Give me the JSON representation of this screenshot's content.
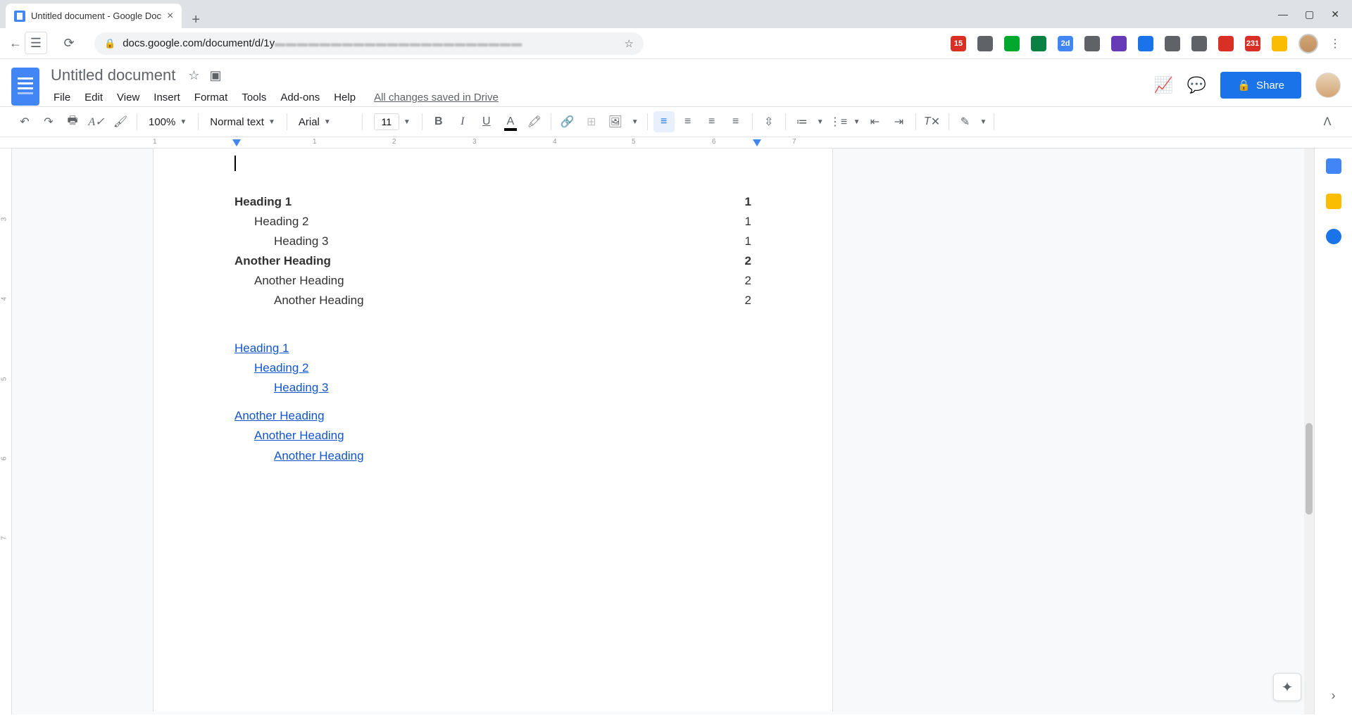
{
  "browser": {
    "tab_title": "Untitled document - Google Doc",
    "url_prefix": "docs.google.com/document/d/1y",
    "url_blur": "▬▬▬▬▬▬▬▬▬▬▬▬▬▬▬▬▬▬▬▬▬▬"
  },
  "docs": {
    "title": "Untitled document",
    "menu": [
      "File",
      "Edit",
      "View",
      "Insert",
      "Format",
      "Tools",
      "Add-ons",
      "Help"
    ],
    "save_status": "All changes saved in Drive",
    "share_label": "Share"
  },
  "toolbar": {
    "zoom": "100%",
    "style": "Normal text",
    "font": "Arial",
    "font_size": "11"
  },
  "ruler": {
    "ticks": [
      "1",
      "1",
      "2",
      "3",
      "4",
      "5",
      "6",
      "7"
    ],
    "tick_positions": [
      0,
      227,
      340,
      454,
      568,
      680,
      794,
      908
    ]
  },
  "v_ruler": {
    "ticks": [
      "3",
      "4",
      "5",
      "6",
      "7"
    ],
    "positions": [
      95,
      208,
      322,
      435,
      548
    ]
  },
  "toc_plain": [
    {
      "text": "Heading 1",
      "page": "1",
      "level": 1
    },
    {
      "text": "Heading 2",
      "page": "1",
      "level": 2
    },
    {
      "text": "Heading 3",
      "page": "1",
      "level": 3
    },
    {
      "text": "Another Heading",
      "page": "2",
      "level": 1
    },
    {
      "text": "Another Heading",
      "page": "2",
      "level": 2
    },
    {
      "text": "Another Heading",
      "page": "2",
      "level": 3
    }
  ],
  "toc_links": [
    {
      "text": "Heading 1",
      "level": 1,
      "group": 0
    },
    {
      "text": "Heading 2",
      "level": 2,
      "group": 0
    },
    {
      "text": "Heading 3",
      "level": 3,
      "group": 0
    },
    {
      "text": "Another Heading",
      "level": 1,
      "group": 1
    },
    {
      "text": "Another Heading",
      "level": 2,
      "group": 1
    },
    {
      "text": "Another Heading",
      "level": 3,
      "group": 1
    }
  ],
  "ext_colors": [
    "#d93025",
    "#5f6368",
    "#00a82d",
    "#0b8043",
    "#4285f4",
    "#5f6368",
    "#673ab7",
    "#1a73e8",
    "#5f6368",
    "#5f6368",
    "#d93025",
    "#d93025",
    "#fbbc04"
  ],
  "ext_badge": [
    "15",
    "",
    "",
    "",
    "2d",
    "",
    "",
    "",
    "",
    "",
    "",
    "231",
    ""
  ]
}
